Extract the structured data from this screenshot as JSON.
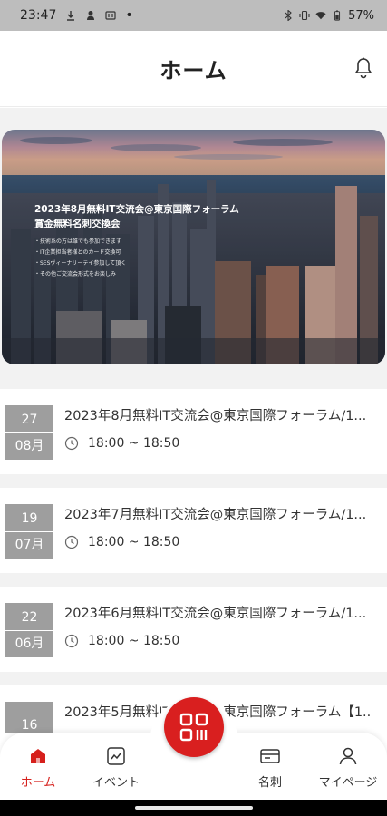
{
  "status_bar": {
    "time": "23:47",
    "battery": "57%"
  },
  "header": {
    "title": "ホーム"
  },
  "banner": {
    "title_line1": "2023年8月無料IT交流会@東京国際フォーラム",
    "title_line2": "賞金無料名刺交換会",
    "bullets": [
      "・技術系の方は誰でも参加できます",
      "・IT企業担当者様とのカード交換可",
      "・SESヴィーナリーテイ参加して頂く",
      "・その他ご交流会形式をお楽しみ"
    ]
  },
  "events": [
    {
      "day": "27",
      "month": "08月",
      "title": "2023年8月無料IT交流会@東京国際フォーラム/1...",
      "time": "18:00 ~ 18:50"
    },
    {
      "day": "19",
      "month": "07月",
      "title": "2023年7月無料IT交流会@東京国際フォーラム/1...",
      "time": "18:00 ~ 18:50"
    },
    {
      "day": "22",
      "month": "06月",
      "title": "2023年6月無料IT交流会@東京国際フォーラム/1...",
      "time": "18:00 ~ 18:50"
    },
    {
      "day": "16",
      "month": "",
      "title": "2023年5月無料IT交流会@東京国際フォーラム【1...",
      "time": ""
    }
  ],
  "nav": {
    "home": "ホーム",
    "event": "イベント",
    "card": "名刺",
    "mypage": "マイページ"
  },
  "colors": {
    "accent": "#d91f1f",
    "date_box": "#9e9e9e"
  },
  "icons": {
    "bell": "bell-icon",
    "qr": "qr-scan-icon",
    "clock": "clock-icon"
  }
}
